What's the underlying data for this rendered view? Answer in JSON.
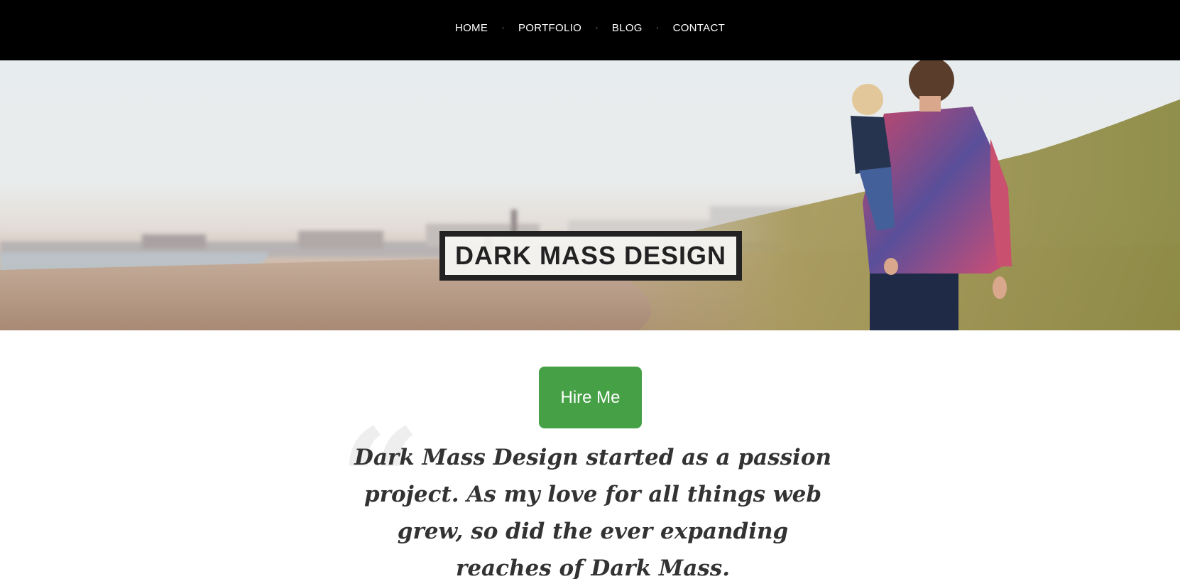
{
  "nav": {
    "items": [
      {
        "label": "HOME"
      },
      {
        "label": "PORTFOLIO"
      },
      {
        "label": "BLOG"
      },
      {
        "label": "CONTACT"
      }
    ],
    "separator": "•"
  },
  "hero": {
    "title": "DARK MASS DESIGN",
    "image": "beach-dunes-father-child-photo"
  },
  "cta": {
    "hire_label": "Hire Me",
    "color": "#46a046"
  },
  "about": {
    "quote_mark": "“",
    "text": "Dark Mass Design started as a passion project. As my love for all things web grew, so did the ever expanding reaches of Dark Mass."
  }
}
